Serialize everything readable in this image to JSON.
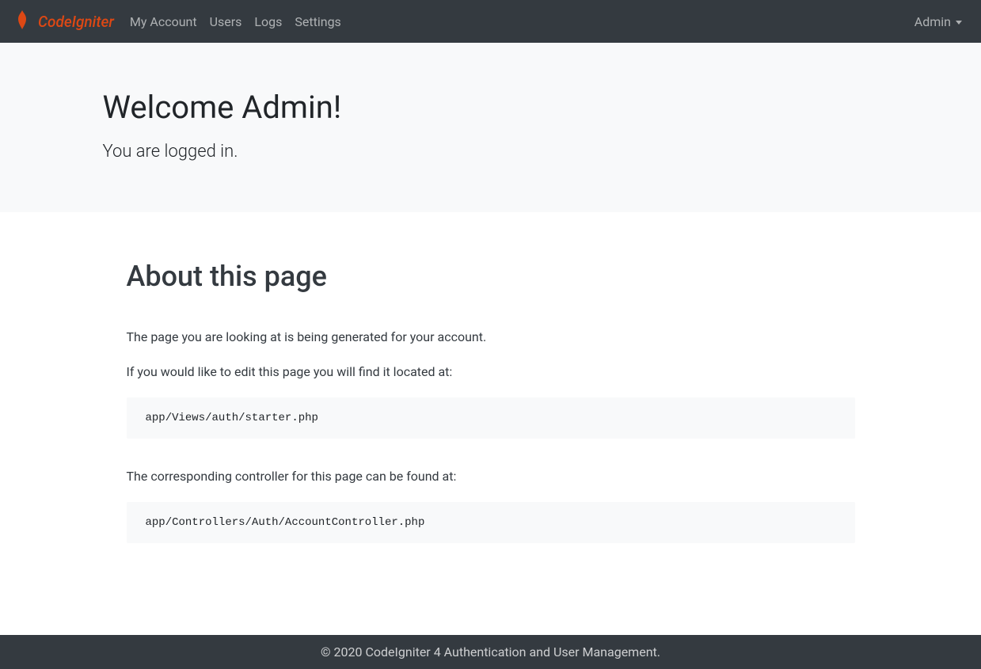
{
  "brand": {
    "name": "CodeIgniter"
  },
  "nav": {
    "items": [
      {
        "label": "My Account"
      },
      {
        "label": "Users"
      },
      {
        "label": "Logs"
      },
      {
        "label": "Settings"
      }
    ],
    "user_menu": {
      "label": "Admin"
    }
  },
  "hero": {
    "title": "Welcome Admin!",
    "subtitle": "You are logged in."
  },
  "about": {
    "heading": "About this page",
    "paragraph1": "The page you are looking at is being generated for your account.",
    "paragraph2": "If you would like to edit this page you will find it located at:",
    "code1": "app/Views/auth/starter.php",
    "paragraph3": "The corresponding controller for this page can be found at:",
    "code2": "app/Controllers/Auth/AccountController.php"
  },
  "footer": {
    "text": "© 2020 CodeIgniter 4 Authentication and User Management."
  }
}
